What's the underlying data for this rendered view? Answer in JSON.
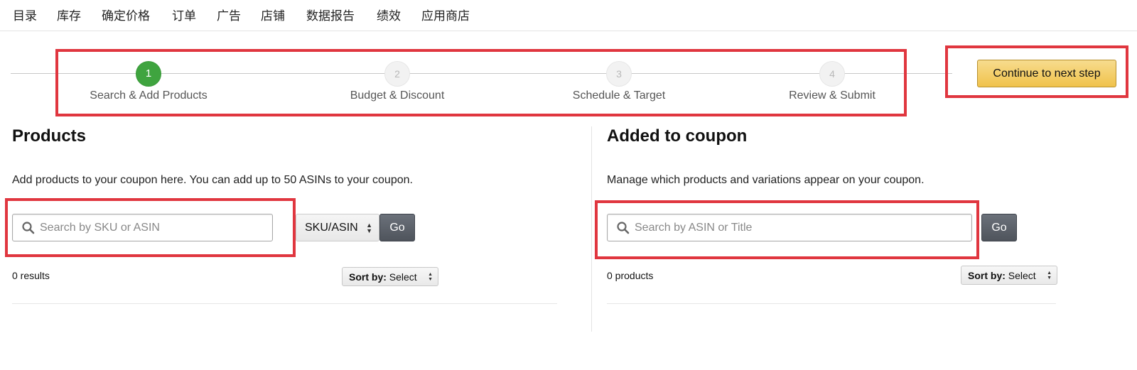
{
  "nav": {
    "items": [
      "目录",
      "库存",
      "确定价格",
      "订单",
      "广告",
      "店铺",
      "数据报告",
      "绩效",
      "应用商店"
    ]
  },
  "stepper": {
    "steps": [
      {
        "number": "1",
        "label": "Search & Add Products",
        "active": true
      },
      {
        "number": "2",
        "label": "Budget & Discount",
        "active": false
      },
      {
        "number": "3",
        "label": "Schedule & Target",
        "active": false
      },
      {
        "number": "4",
        "label": "Review & Submit",
        "active": false
      }
    ],
    "continue_label": "Continue to next step"
  },
  "products": {
    "title": "Products",
    "description": "Add products to your coupon here. You can add up to 50 ASINs to your coupon.",
    "search_placeholder": "Search by SKU or ASIN",
    "search_value": "",
    "type_select": "SKU/ASIN",
    "go_label": "Go",
    "results_count": "0 results",
    "sort_label": "Sort by:",
    "sort_value": "Select"
  },
  "coupon": {
    "title": "Added to coupon",
    "description": "Manage which products and variations appear on your coupon.",
    "search_placeholder": "Search by ASIN or Title",
    "search_value": "",
    "go_label": "Go",
    "products_count": "0 products",
    "sort_label": "Sort by:",
    "sort_value": "Select"
  },
  "colors": {
    "highlight": "#e0363f",
    "active_step": "#3fa43f",
    "continue_button": "#f0c24b",
    "go_button": "#5a5f67"
  },
  "icons": [
    "search-icon",
    "sort-arrows-icon",
    "select-arrows-icon"
  ]
}
